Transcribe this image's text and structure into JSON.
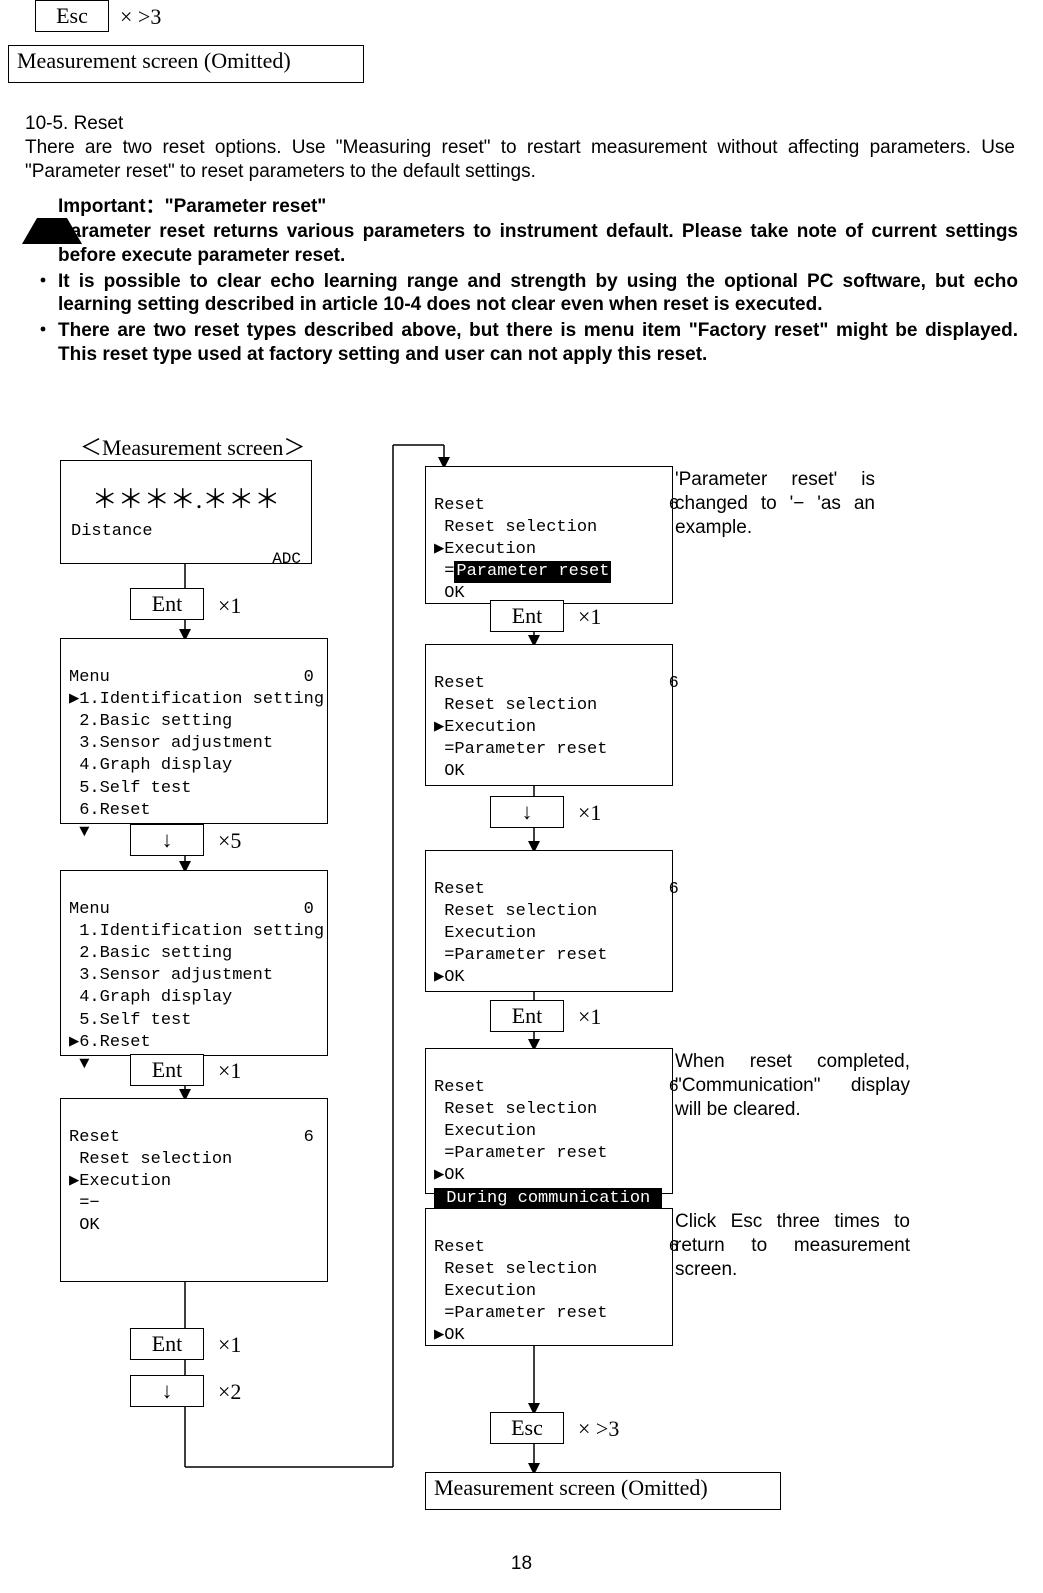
{
  "top": {
    "esc_label": "Esc",
    "esc_count": "× >3",
    "meas_screen_label": "Measurement screen (Omitted)"
  },
  "section": {
    "heading": "10-5. Reset",
    "intro": "There are two reset options. Use \"Measuring reset\" to restart measurement without affecting parameters. Use \"Parameter reset\" to reset parameters to the default settings."
  },
  "important": {
    "title": "Important：\"Parameter reset\"",
    "bullets": [
      "Parameter reset returns various parameters to instrument default. Please take note of current settings before execute parameter reset.",
      "It is possible to clear echo learning range and strength by using the optional PC software, but echo learning setting described in article 10-4 does not clear even when reset is executed.",
      "There are two reset types described above, but there is menu item \"Factory reset\" might be displayed. This reset type used at factory setting and user can not apply this reset."
    ]
  },
  "left": {
    "meas_title": "＜Measurement screen＞",
    "meas_value": "＊＊＊＊.＊＊＊",
    "meas_label": "Distance",
    "meas_indicator": "ADC",
    "key_ent": "Ent",
    "key_down": "↓",
    "x1": "×1",
    "x5": "×5",
    "x2": "×2",
    "menu_header": "Menu                   0",
    "menu_caret": "▶",
    "menu_items": [
      "1.Identification setting",
      "2.Basic setting",
      "3.Sensor adjustment",
      "4.Graph display",
      "5.Self test",
      "6.Reset"
    ],
    "menu_more": " ▼",
    "reset_header": "Reset                  6",
    "reset_body_a": " Reset selection",
    "reset_body_b1": "▶Execution",
    "reset_body_b2": " =−",
    "reset_body_c": " OK"
  },
  "right": {
    "key_ent": "Ent",
    "key_down": "↓",
    "key_esc": "Esc",
    "x1": "×1",
    "xgt3": "× >3",
    "reset_header": "Reset                  6",
    "r_sel": " Reset selection",
    "r_exec_caret": "▶Execution",
    "r_exec": " Execution",
    "r_eq_paramreset_inv": " =",
    "paramreset_inv": "Parameter reset",
    "r_eq_paramreset": " =Parameter reset",
    "r_ok": " OK",
    "r_ok_caret": "▶OK",
    "during_comm": " During communication ",
    "meas_omitted": "Measurement screen (Omitted)"
  },
  "notes": {
    "n1": "'Parameter reset' is changed to '− 'as an example.",
    "n2": "When reset completed, \"Communication\" display will be cleared.",
    "n3": "Click Esc three times to return to measurement screen."
  },
  "page_number": "18"
}
